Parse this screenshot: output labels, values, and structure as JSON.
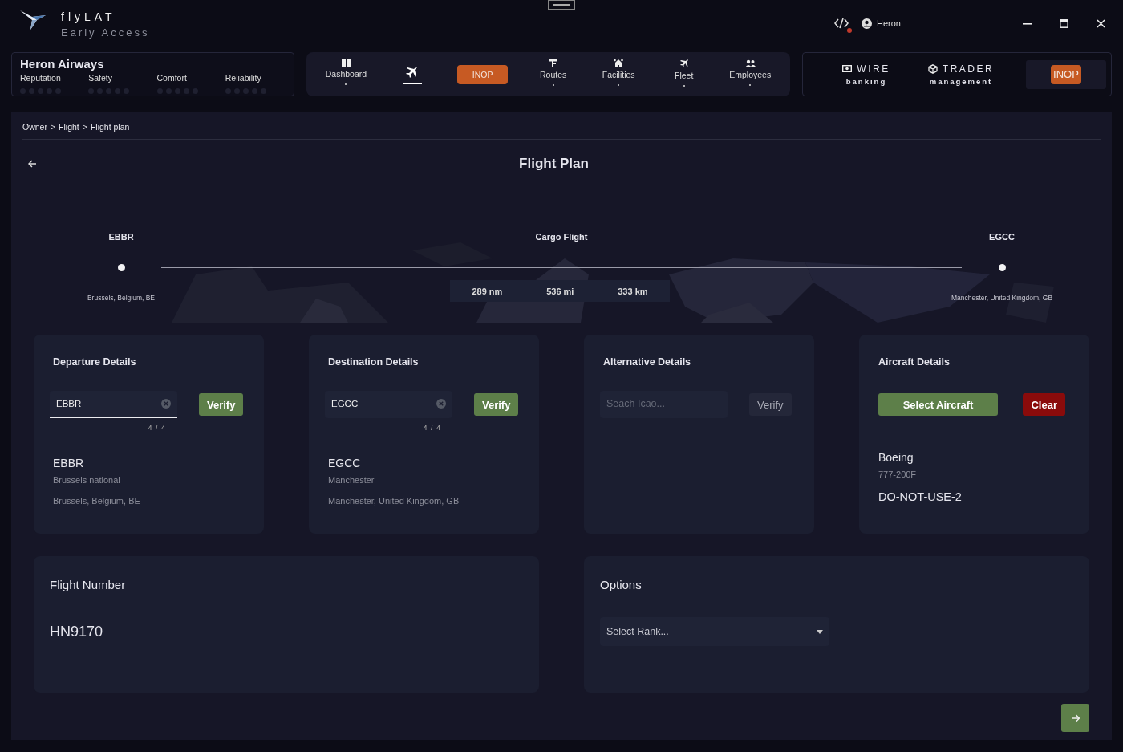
{
  "app": {
    "name": "flyLAT",
    "subtitle": "Early Access"
  },
  "header": {
    "user": "Heron",
    "dev_alert": true
  },
  "airline": {
    "name": "Heron Airways",
    "ratings": [
      {
        "label": "Reputation",
        "stars": 0
      },
      {
        "label": "Safety",
        "stars": 0
      },
      {
        "label": "Comfort",
        "stars": 0
      },
      {
        "label": "Reliability",
        "stars": 0
      }
    ]
  },
  "nav": [
    {
      "kind": "item",
      "label": "Dashboard",
      "selected": false
    },
    {
      "kind": "icon",
      "selected": true
    },
    {
      "kind": "badge",
      "label": "INOP"
    },
    {
      "kind": "item",
      "label": "Routes",
      "selected": false
    },
    {
      "kind": "item",
      "label": "Facilities",
      "selected": false
    },
    {
      "kind": "item",
      "label": "Fleet",
      "selected": false
    },
    {
      "kind": "item",
      "label": "Employees",
      "selected": false
    }
  ],
  "services": [
    {
      "kind": "item",
      "title": "WIRE",
      "subtitle": "banking"
    },
    {
      "kind": "item",
      "title": "TRADER",
      "subtitle": "management"
    },
    {
      "kind": "covered",
      "badge": "INOP"
    }
  ],
  "breadcrumb": {
    "items": [
      "Owner",
      "Flight",
      "Flight plan"
    ],
    "separator": ">"
  },
  "title": "Flight Plan",
  "route": {
    "from": {
      "code": "EBBR",
      "place": "Brussels, Belgium, BE"
    },
    "type": "Cargo Flight",
    "to": {
      "code": "EGCC",
      "place": "Manchester, United Kingdom, GB"
    },
    "distances": [
      "289 nm",
      "536 mi",
      "333 km"
    ]
  },
  "cards": [
    {
      "kind": "airport",
      "title": "Departure Details",
      "input": {
        "value": "EBBR",
        "counter": "4 / 4",
        "focused": true
      },
      "button": {
        "label": "Verify",
        "enabled": true
      },
      "result": {
        "code": "EBBR",
        "name": "Brussels national",
        "place": "Brussels, Belgium, BE"
      }
    },
    {
      "kind": "airport",
      "title": "Destination Details",
      "input": {
        "value": "EGCC",
        "counter": "4 / 4",
        "focused": false
      },
      "button": {
        "label": "Verify",
        "enabled": true
      },
      "result": {
        "code": "EGCC",
        "name": "Manchester",
        "place": "Manchester, United Kingdom, GB"
      }
    },
    {
      "kind": "airport",
      "title": "Alternative Details",
      "input": {
        "placeholder": "Seach Icao...",
        "focused": false
      },
      "button": {
        "label": "Verify",
        "enabled": false
      }
    },
    {
      "kind": "aircraft",
      "title": "Aircraft Details",
      "select_button": "Select Aircraft",
      "clear_button": "Clear",
      "maker": "Boeing",
      "model": "777-200F",
      "registration": "DO-NOT-USE-2"
    }
  ],
  "flight_number": {
    "title": "Flight Number",
    "value": "HN9170"
  },
  "options": {
    "title": "Options",
    "select": {
      "placeholder": "Select Rank..."
    }
  }
}
